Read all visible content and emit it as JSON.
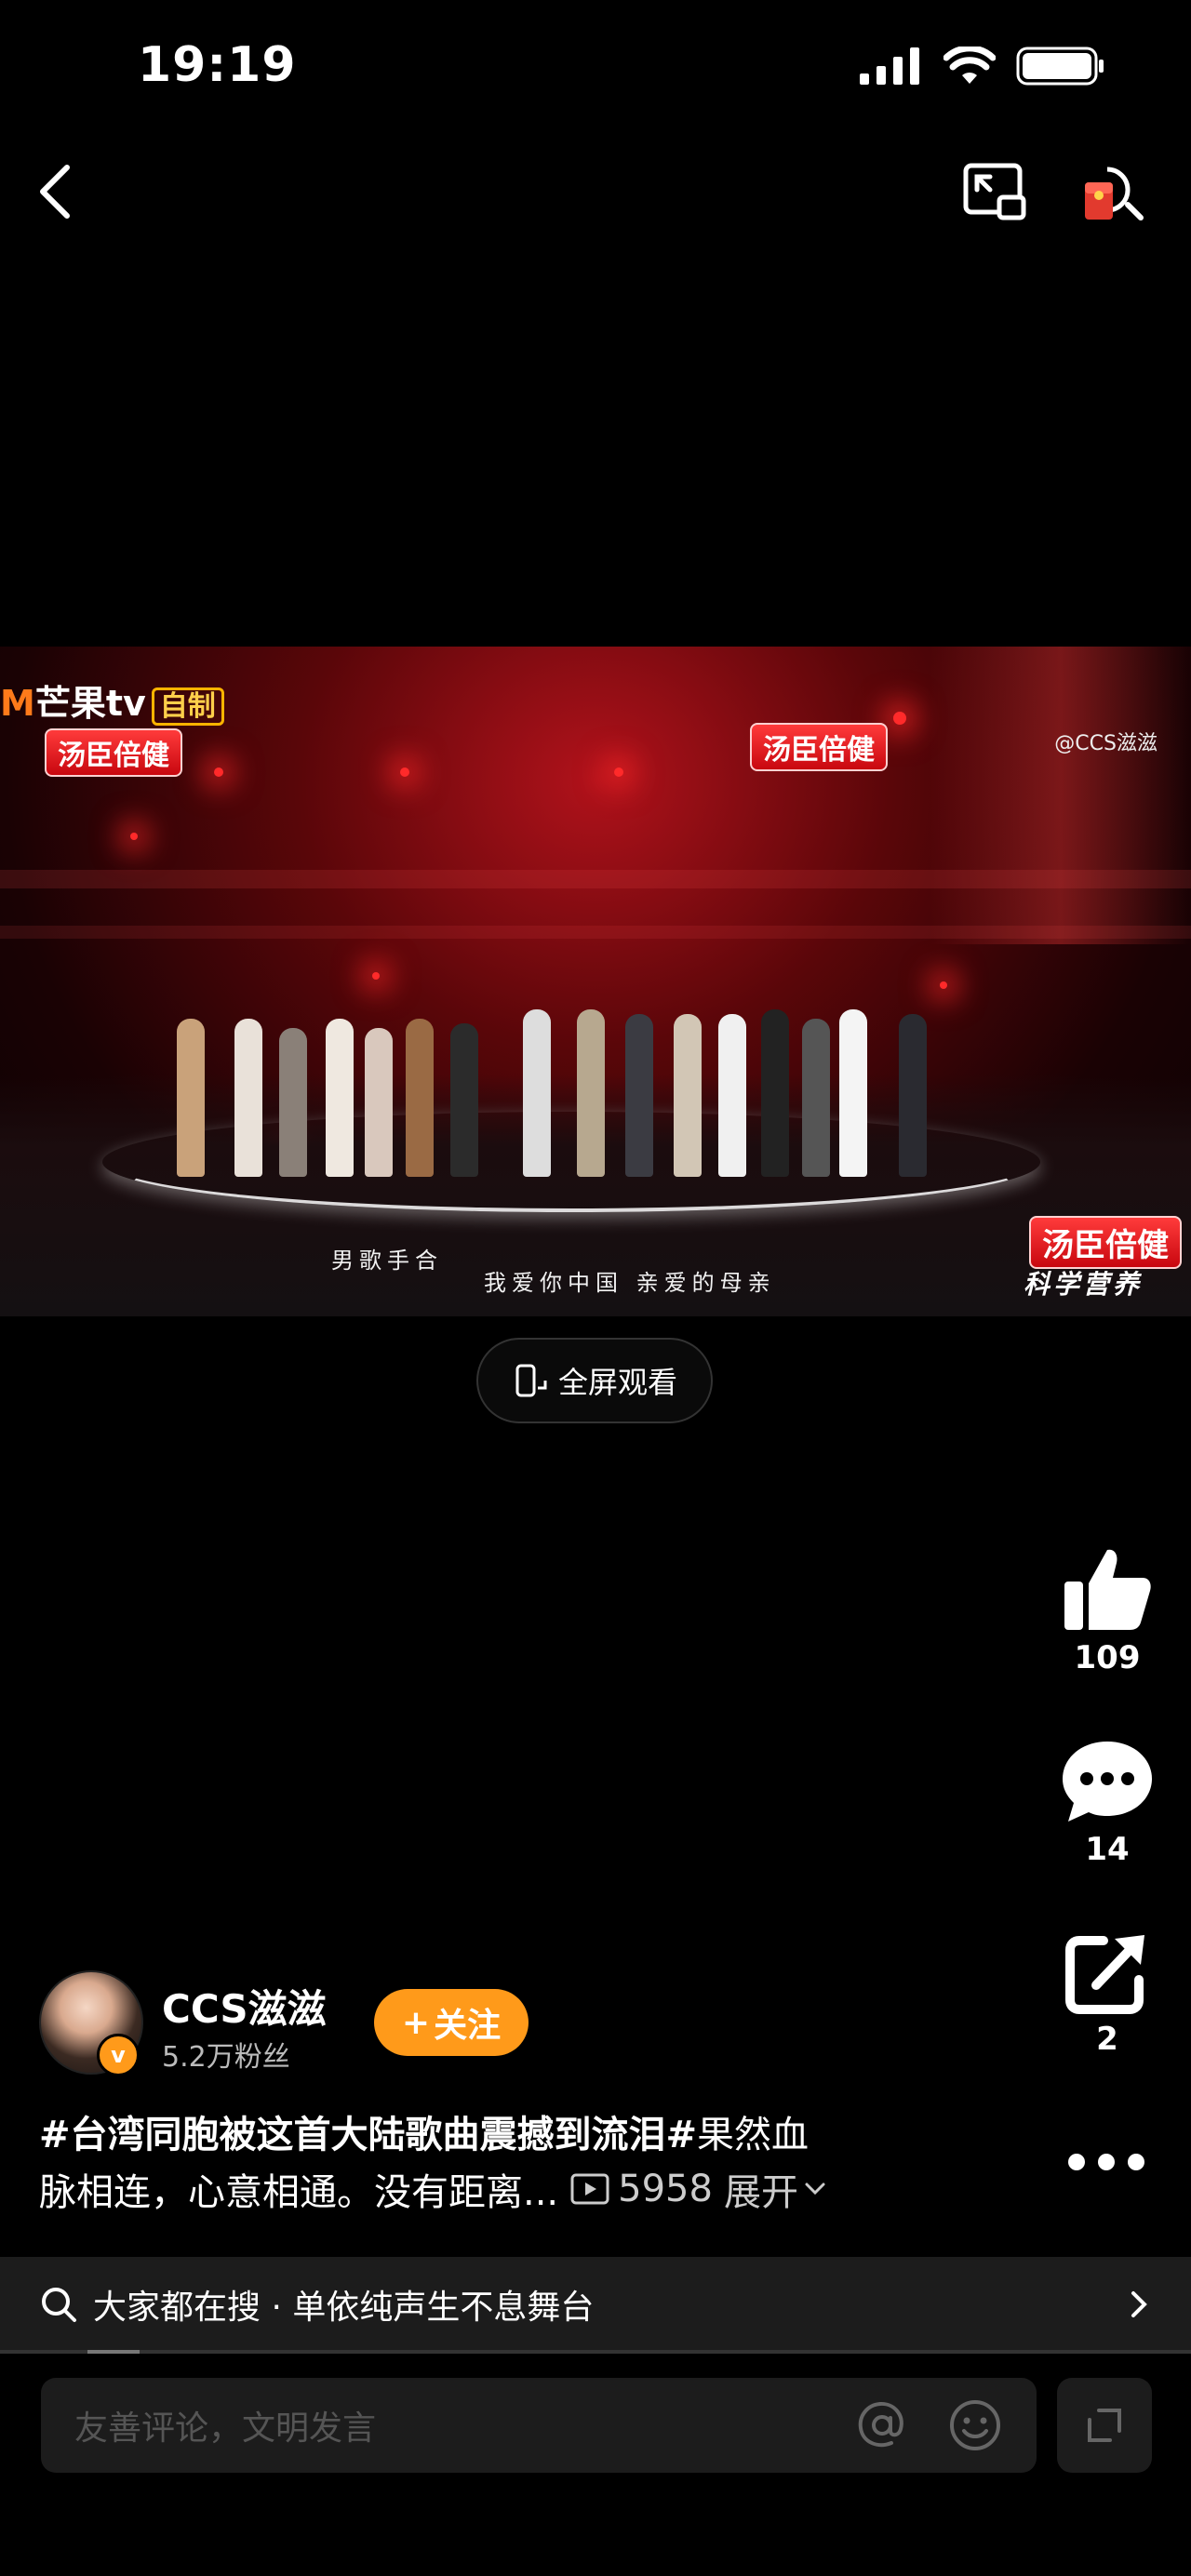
{
  "status_bar": {
    "time": "19:19"
  },
  "video": {
    "logo_text": "芒果tv",
    "logo_tag": "自制",
    "sponsor": "汤臣倍健",
    "sponsor_sub": "科学营养",
    "watermark": "@CCS滋滋",
    "subtitle_left": "男歌手合",
    "subtitle_main": "我爱你中国 亲爱的母亲"
  },
  "fullscreen_label": "全屏观看",
  "actions": {
    "likes": "109",
    "comments": "14",
    "shares": "2"
  },
  "author": {
    "name": "CCS滋滋",
    "fans": "5.2万粉丝",
    "follow_label": "关注"
  },
  "description": {
    "line1_tag": "#台湾同胞被这首大陆歌曲震撼到流泪#",
    "line1_rest": "果然血",
    "line2": "脉相连，心意相通。没有距离...",
    "views": "5958",
    "expand": "展开"
  },
  "search_bar": {
    "text": "大家都在搜 · 单依纯声生不息舞台"
  },
  "comment_input": {
    "placeholder": "友善评论，文明发言"
  },
  "colors": {
    "accent": "#ff9a1a",
    "background": "#000000",
    "bar": "#1c1c1c"
  }
}
